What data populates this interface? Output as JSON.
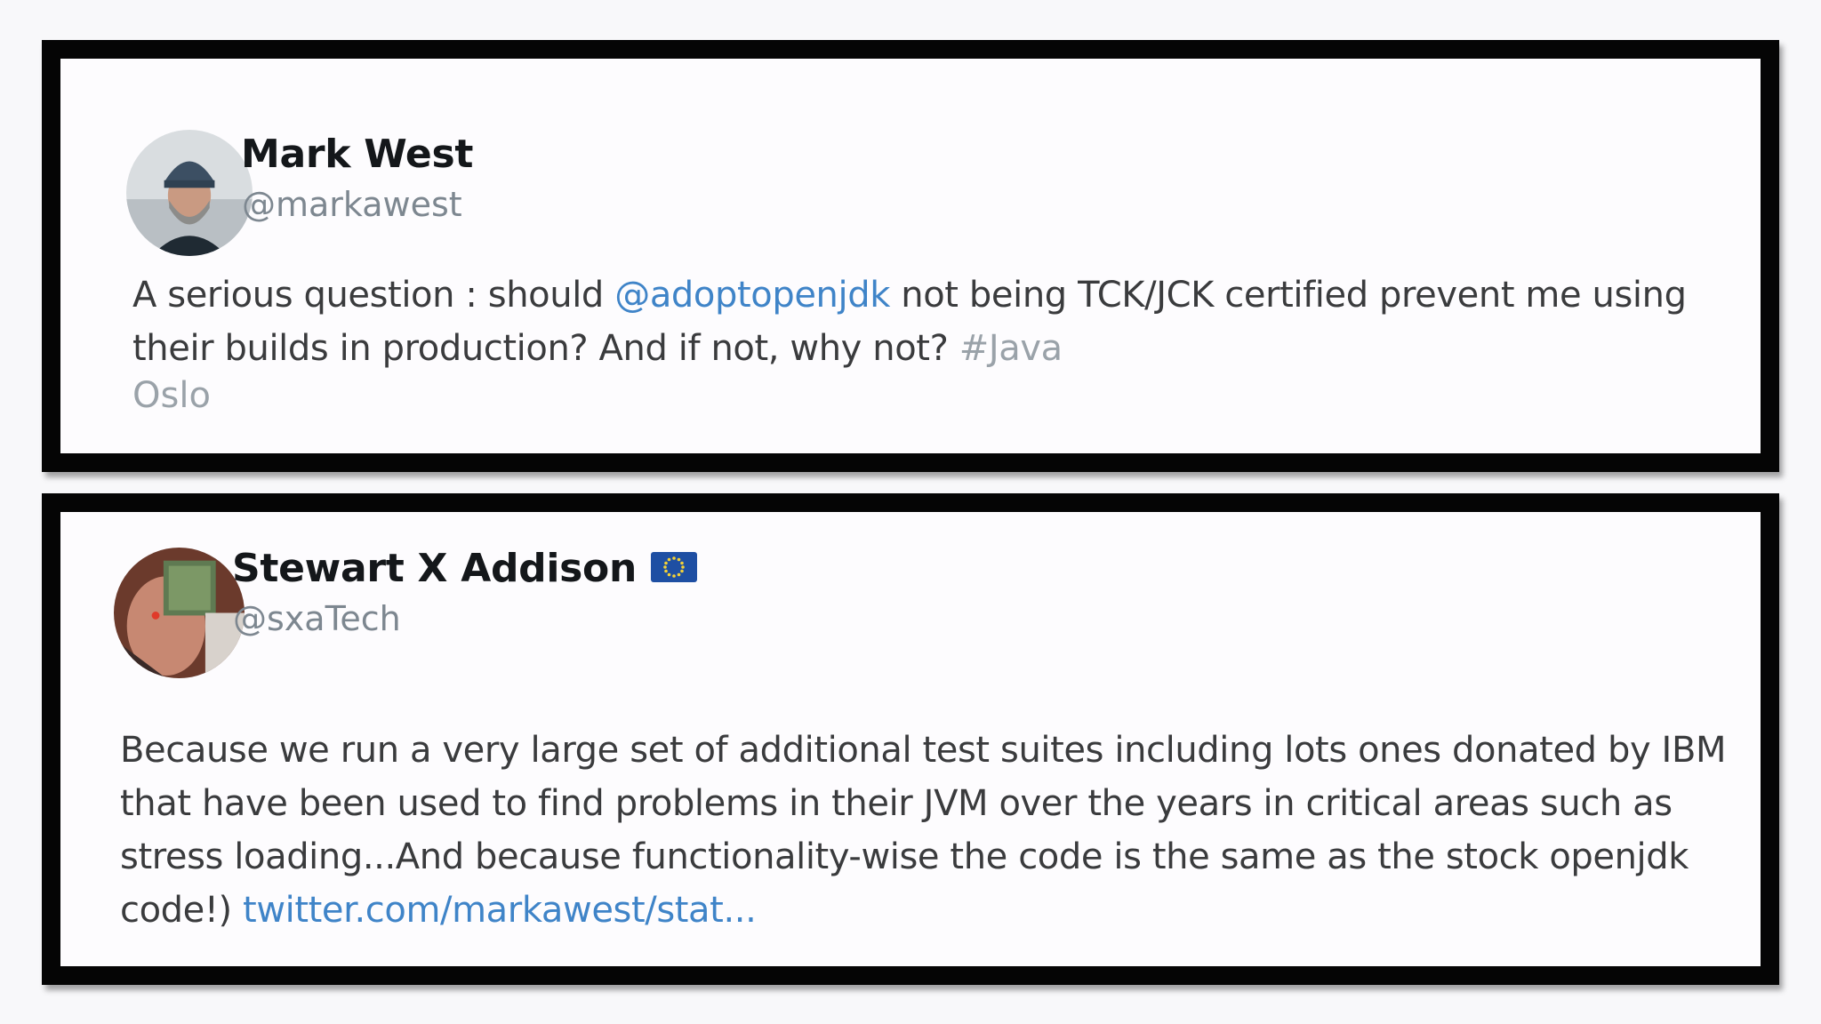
{
  "tweets": [
    {
      "author": {
        "name": "Mark West",
        "handle": "@markawest"
      },
      "text": {
        "part1": "A serious question : should ",
        "mention": "@adoptopenjdk",
        "part2": " not being TCK/JCK certified prevent me using their builds in production? And if not, why not? ",
        "hashtag": "#Java"
      },
      "location": "Oslo"
    },
    {
      "author": {
        "name": "Stewart X Addison",
        "flag_icon": "eu-flag-icon",
        "handle": "@sxaTech"
      },
      "text": {
        "body": "Because we run a very large set of additional test suites including lots ones donated by IBM that have been used to find problems in their JVM over the years in critical areas such as stress loading...And because functionality-wise the code is the same as the stock openjdk code!) ",
        "link": "twitter.com/markawest/stat..."
      }
    }
  ],
  "colors": {
    "mention": "#3f84c8",
    "hashtag": "#9aa2a9",
    "handle": "#7d8790",
    "card_border": "#050505"
  }
}
